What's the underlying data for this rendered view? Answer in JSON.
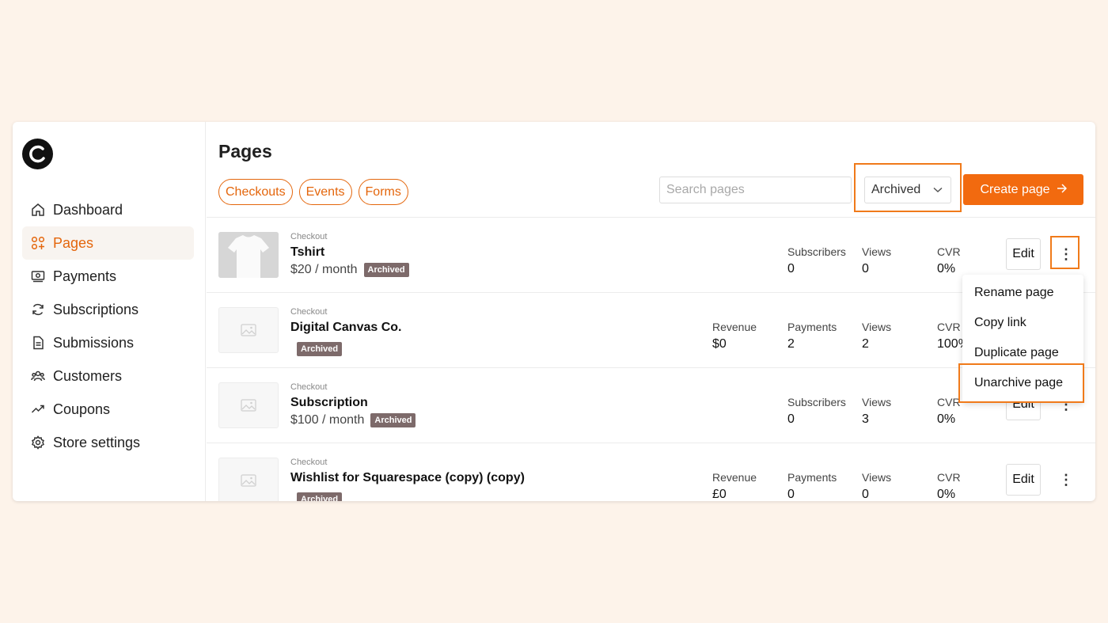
{
  "sidebar": {
    "items": [
      {
        "label": "Dashboard",
        "icon": "home-icon"
      },
      {
        "label": "Pages",
        "icon": "pages-icon",
        "active": true
      },
      {
        "label": "Payments",
        "icon": "payments-icon"
      },
      {
        "label": "Subscriptions",
        "icon": "refresh-icon"
      },
      {
        "label": "Submissions",
        "icon": "document-icon"
      },
      {
        "label": "Customers",
        "icon": "users-icon"
      },
      {
        "label": "Coupons",
        "icon": "trending-icon"
      },
      {
        "label": "Store settings",
        "icon": "gear-icon"
      }
    ]
  },
  "header": {
    "title": "Pages",
    "filters": [
      "Checkouts",
      "Events",
      "Forms"
    ],
    "search_placeholder": "Search pages",
    "status_select": "Archived",
    "create_label": "Create page"
  },
  "rows": [
    {
      "type": "Checkout",
      "title": "Tshirt",
      "price": "$20 / month",
      "badge": "Archived",
      "stats": [
        {
          "label": "Subscribers",
          "value": "0"
        },
        {
          "label": "Views",
          "value": "0"
        },
        {
          "label": "CVR",
          "value": "0%"
        }
      ]
    },
    {
      "type": "Checkout",
      "title": "Digital Canvas Co.",
      "price": "",
      "badge": "Archived",
      "stats": [
        {
          "label": "Revenue",
          "value": "$0"
        },
        {
          "label": "Payments",
          "value": "2"
        },
        {
          "label": "Views",
          "value": "2"
        },
        {
          "label": "CVR",
          "value": "100%"
        }
      ]
    },
    {
      "type": "Checkout",
      "title": "Subscription",
      "price": "$100 / month",
      "badge": "Archived",
      "stats": [
        {
          "label": "Subscribers",
          "value": "0"
        },
        {
          "label": "Views",
          "value": "3"
        },
        {
          "label": "CVR",
          "value": "0%"
        }
      ]
    },
    {
      "type": "Checkout",
      "title": "Wishlist for Squarespace (copy) (copy)",
      "price": "",
      "badge": "Archived",
      "stats": [
        {
          "label": "Revenue",
          "value": "£0"
        },
        {
          "label": "Payments",
          "value": "0"
        },
        {
          "label": "Views",
          "value": "0"
        },
        {
          "label": "CVR",
          "value": "0%"
        }
      ]
    }
  ],
  "row_actions": {
    "edit_label": "Edit",
    "more_label": "⋮"
  },
  "menu": {
    "items": [
      "Rename page",
      "Copy link",
      "Duplicate page",
      "Unarchive page"
    ]
  },
  "colors": {
    "accent": "#f26a0f",
    "highlight": "#f07a1a",
    "badge": "#7d6a6a"
  }
}
